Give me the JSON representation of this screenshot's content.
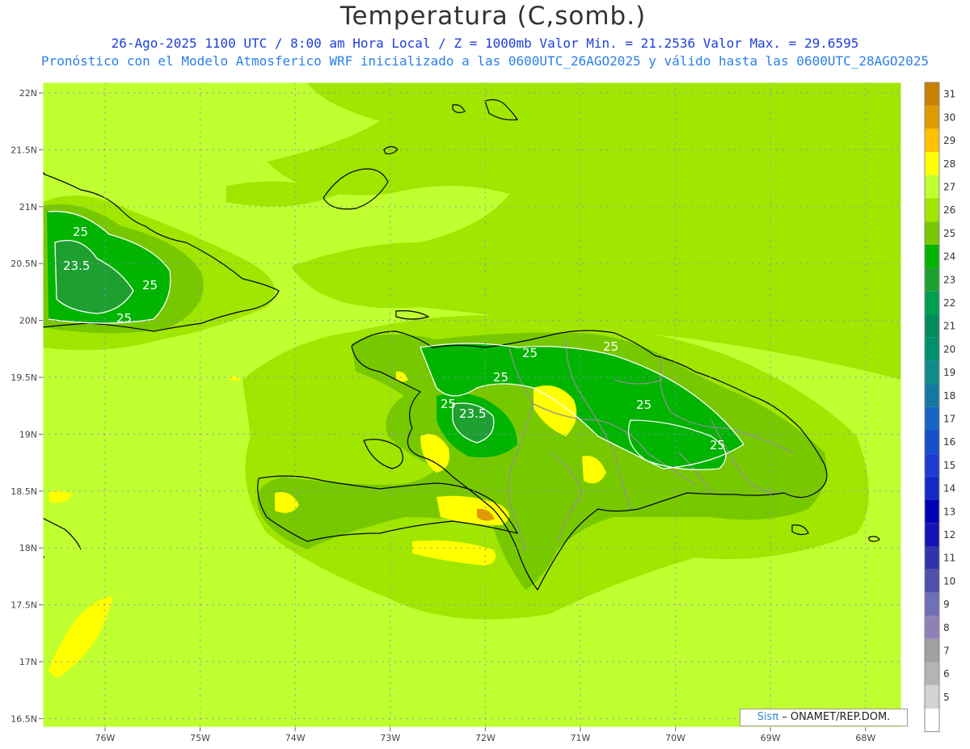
{
  "header": {
    "title": "Temperatura (C,somb.)",
    "subtitle": "26-Ago-2025  1100 UTC / 8:00 am Hora Local / Z = 1000mb   Valor Min. = 21.2536  Valor Max. = 29.6595",
    "subtitle2": "Pronóstico con el Modelo Atmosferico WRF inicializado a las 0600UTC_26AGO2025 y válido hasta las  0600UTC_28AGO2025"
  },
  "axes": {
    "lat_labels": [
      "22N",
      "21.5N",
      "21N",
      "20.5N",
      "20N",
      "19.5N",
      "19N",
      "18.5N",
      "18N",
      "17.5N",
      "17N",
      "16.5N"
    ],
    "lon_labels": [
      "76W",
      "75W",
      "74W",
      "73W",
      "72W",
      "71W",
      "70W",
      "69W",
      "68W"
    ]
  },
  "legend": {
    "levels": [
      "31",
      "30",
      "29",
      "28",
      "27",
      "26",
      "25",
      "24",
      "23",
      "22",
      "21",
      "20",
      "19",
      "18",
      "17",
      "16",
      "15",
      "14",
      "13",
      "12",
      "11",
      "10",
      "9",
      "8",
      "7",
      "6",
      "5"
    ],
    "colors": [
      "#c88000",
      "#e09a00",
      "#ffc000",
      "#ffff00",
      "#c0ff30",
      "#a0e600",
      "#78c800",
      "#00b400",
      "#1ea030",
      "#00a050",
      "#008c5a",
      "#00906e",
      "#108c8c",
      "#1478a0",
      "#1464c8",
      "#1450c8",
      "#1e3cd2",
      "#1428c8",
      "#0000b4",
      "#1414b4",
      "#3232aa",
      "#5050aa",
      "#7070b4",
      "#9080b8",
      "#a0a0a0",
      "#b4b4b4",
      "#d2d2d2",
      "#ffffff"
    ]
  },
  "contour_labels": {
    "cuba": [
      "25",
      "23.5",
      "25",
      "25"
    ],
    "hispaniola": [
      "25",
      "25",
      "25",
      "25",
      "23.5",
      "25",
      "25"
    ]
  },
  "credit": {
    "sis": "Sisπ",
    "text": " – ONAMET/REP.DOM."
  }
}
